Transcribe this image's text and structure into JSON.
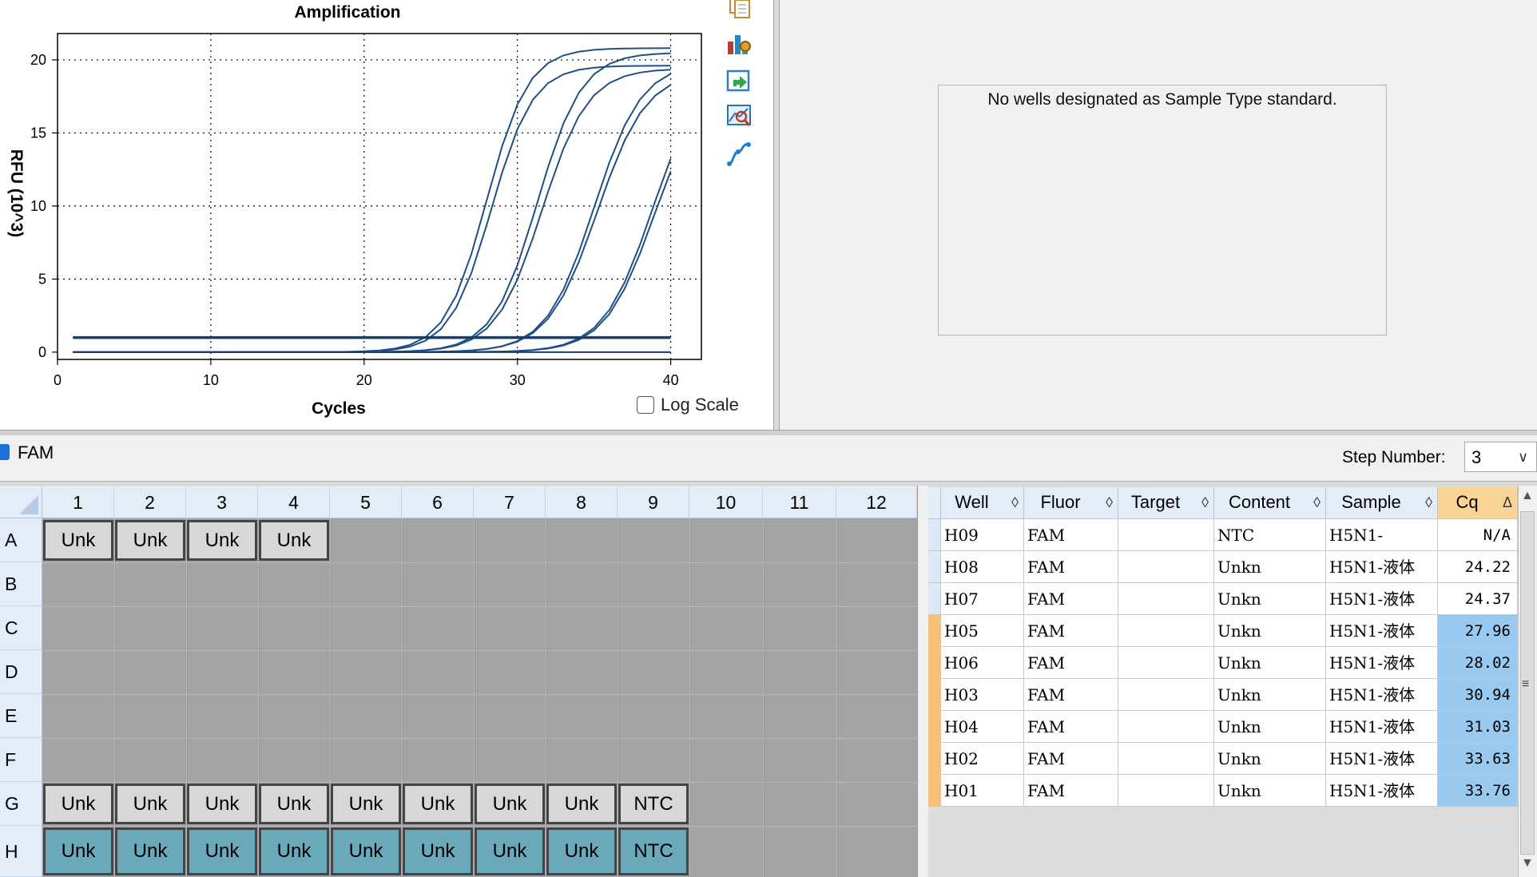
{
  "chart_data": {
    "type": "line",
    "title": "Amplification",
    "xlabel": "Cycles",
    "ylabel": "RFU (10^3)",
    "xlim": [
      0,
      42
    ],
    "ylim": [
      -0.5,
      21.8
    ],
    "xticks": [
      0,
      10,
      20,
      30,
      40
    ],
    "yticks": [
      0,
      5,
      10,
      15,
      20
    ],
    "grid": true,
    "line_color": "#1f4f86",
    "x": [
      1,
      2,
      3,
      4,
      5,
      6,
      7,
      8,
      9,
      10,
      11,
      12,
      13,
      14,
      15,
      16,
      17,
      18,
      19,
      20,
      21,
      22,
      23,
      24,
      25,
      26,
      27,
      28,
      29,
      30,
      31,
      32,
      33,
      34,
      35,
      36,
      37,
      38,
      39,
      40
    ],
    "series_params": [
      {
        "ct": 28.0,
        "plateau": 20.8,
        "slope": 1.35
      },
      {
        "ct": 28.3,
        "plateau": 19.6,
        "slope": 1.35
      },
      {
        "ct": 31.3,
        "plateau": 20.5,
        "slope": 1.45
      },
      {
        "ct": 31.6,
        "plateau": 19.4,
        "slope": 1.5
      },
      {
        "ct": 35.0,
        "plateau": 19.8,
        "slope": 1.55
      },
      {
        "ct": 35.2,
        "plateau": 19.2,
        "slope": 1.6
      },
      {
        "ct": 38.8,
        "plateau": 19.5,
        "slope": 1.6
      },
      {
        "ct": 38.9,
        "plateau": 18.6,
        "slope": 1.6
      }
    ],
    "flat_series": [
      {
        "name": "threshold",
        "values_constant": 1.0
      },
      {
        "name": "NTC",
        "values_constant": 0.0
      }
    ]
  },
  "toolbar": {
    "log_scale_label": "Log Scale",
    "icons": [
      "copy-icon",
      "chart-settings-icon",
      "export-icon",
      "zoom-icon",
      "curve-icon"
    ]
  },
  "standard_curve": {
    "message": "No wells designated as Sample Type standard."
  },
  "fluor": {
    "label": "FAM",
    "checked": true
  },
  "step": {
    "label": "Step Number:",
    "value": "3"
  },
  "plate": {
    "columns": [
      "1",
      "2",
      "3",
      "4",
      "5",
      "6",
      "7",
      "8",
      "9",
      "10",
      "11",
      "12"
    ],
    "rows": [
      "A",
      "B",
      "C",
      "D",
      "E",
      "F",
      "G",
      "H"
    ],
    "wells": {
      "A": [
        "Unk",
        "Unk",
        "Unk",
        "Unk",
        "",
        "",
        "",
        "",
        "",
        "",
        "",
        ""
      ],
      "B": [
        "",
        "",
        "",
        "",
        "",
        "",
        "",
        "",
        "",
        "",
        "",
        ""
      ],
      "C": [
        "",
        "",
        "",
        "",
        "",
        "",
        "",
        "",
        "",
        "",
        "",
        ""
      ],
      "D": [
        "",
        "",
        "",
        "",
        "",
        "",
        "",
        "",
        "",
        "",
        "",
        ""
      ],
      "E": [
        "",
        "",
        "",
        "",
        "",
        "",
        "",
        "",
        "",
        "",
        "",
        ""
      ],
      "F": [
        "",
        "",
        "",
        "",
        "",
        "",
        "",
        "",
        "",
        "",
        "",
        ""
      ],
      "G": [
        "Unk",
        "Unk",
        "Unk",
        "Unk",
        "Unk",
        "Unk",
        "Unk",
        "Unk",
        "NTC",
        "",
        "",
        ""
      ],
      "H": [
        "Unk",
        "Unk",
        "Unk",
        "Unk",
        "Unk",
        "Unk",
        "Unk",
        "Unk",
        "NTC",
        "",
        "",
        ""
      ]
    },
    "selected_row": "H",
    "colors": {
      "well": "#d7d7d7",
      "selected": "#6aa9ba",
      "empty": "#a4a4a4"
    }
  },
  "results": {
    "columns": [
      "Well",
      "Fluor",
      "Target",
      "Content",
      "Sample",
      "Cq"
    ],
    "sort_glyph": "◊",
    "sorted_glyph": "Δ",
    "rows": [
      {
        "well": "H09",
        "fluor": "FAM",
        "target": "",
        "content": "NTC",
        "sample": "H5N1-",
        "cq": "N/A",
        "highlight": false
      },
      {
        "well": "H08",
        "fluor": "FAM",
        "target": "",
        "content": "Unkn",
        "sample": "H5N1-液体",
        "cq": "24.22",
        "highlight": false
      },
      {
        "well": "H07",
        "fluor": "FAM",
        "target": "",
        "content": "Unkn",
        "sample": "H5N1-液体",
        "cq": "24.37",
        "highlight": false
      },
      {
        "well": "H05",
        "fluor": "FAM",
        "target": "",
        "content": "Unkn",
        "sample": "H5N1-液体",
        "cq": "27.96",
        "highlight": true
      },
      {
        "well": "H06",
        "fluor": "FAM",
        "target": "",
        "content": "Unkn",
        "sample": "H5N1-液体",
        "cq": "28.02",
        "highlight": true
      },
      {
        "well": "H03",
        "fluor": "FAM",
        "target": "",
        "content": "Unkn",
        "sample": "H5N1-液体",
        "cq": "30.94",
        "highlight": true
      },
      {
        "well": "H04",
        "fluor": "FAM",
        "target": "",
        "content": "Unkn",
        "sample": "H5N1-液体",
        "cq": "31.03",
        "highlight": true
      },
      {
        "well": "H02",
        "fluor": "FAM",
        "target": "",
        "content": "Unkn",
        "sample": "H5N1-液体",
        "cq": "33.63",
        "highlight": true
      },
      {
        "well": "H01",
        "fluor": "FAM",
        "target": "",
        "content": "Unkn",
        "sample": "H5N1-液体",
        "cq": "33.76",
        "highlight": true
      }
    ],
    "colors": {
      "cq_highlight": "#99c9ee",
      "row_marker": "#f7c078",
      "marker_plain": "#dce8f5"
    }
  }
}
